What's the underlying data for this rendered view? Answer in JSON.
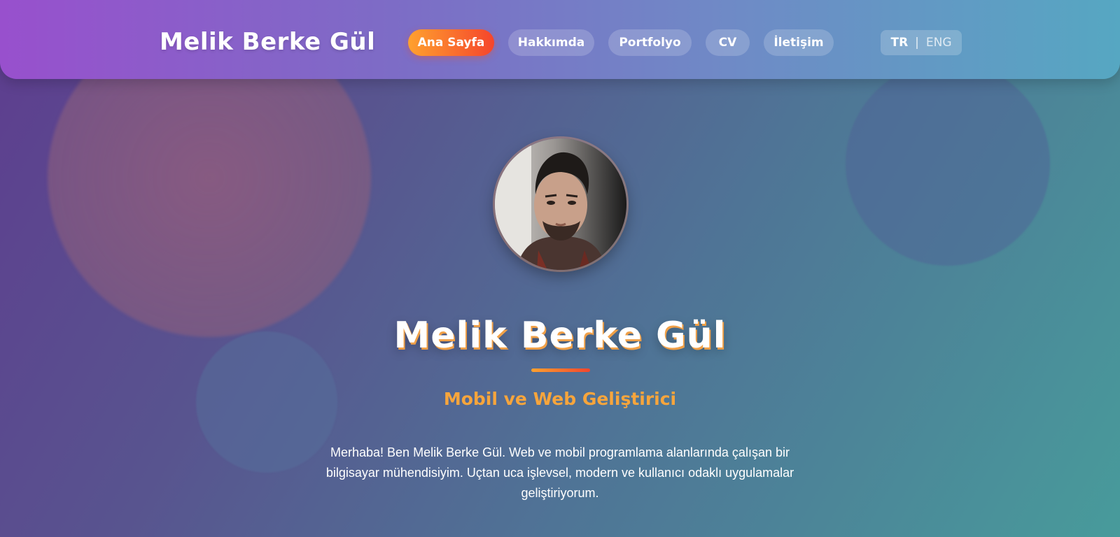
{
  "brand": {
    "name": "Melik Berke Gül"
  },
  "nav": {
    "items": [
      {
        "label": "Ana Sayfa",
        "active": true
      },
      {
        "label": "Hakkımda",
        "active": false
      },
      {
        "label": "Portfolyo",
        "active": false
      },
      {
        "label": "CV",
        "active": false
      },
      {
        "label": "İletişim",
        "active": false
      }
    ]
  },
  "lang": {
    "current": "TR",
    "separator": "|",
    "other": "ENG"
  },
  "hero": {
    "avatar_icon": "profile-photo",
    "name": "Melik Berke Gül",
    "subtitle": "Mobil ve Web Geliştirici",
    "intro": "Merhaba! Ben Melik Berke Gül. Web ve mobil programlama alanlarında çalışan bir bilgisayar mühendisiyim. Uçtan uca işlevsel, modern ve kullanıcı odaklı uygulamalar geliştiriyorum."
  },
  "colors": {
    "accent_start": "#ffa12e",
    "accent_end": "#f5452c",
    "subtitle": "#f7a53c",
    "nav_start": "#9850cd",
    "nav_end": "#56a7c2"
  }
}
